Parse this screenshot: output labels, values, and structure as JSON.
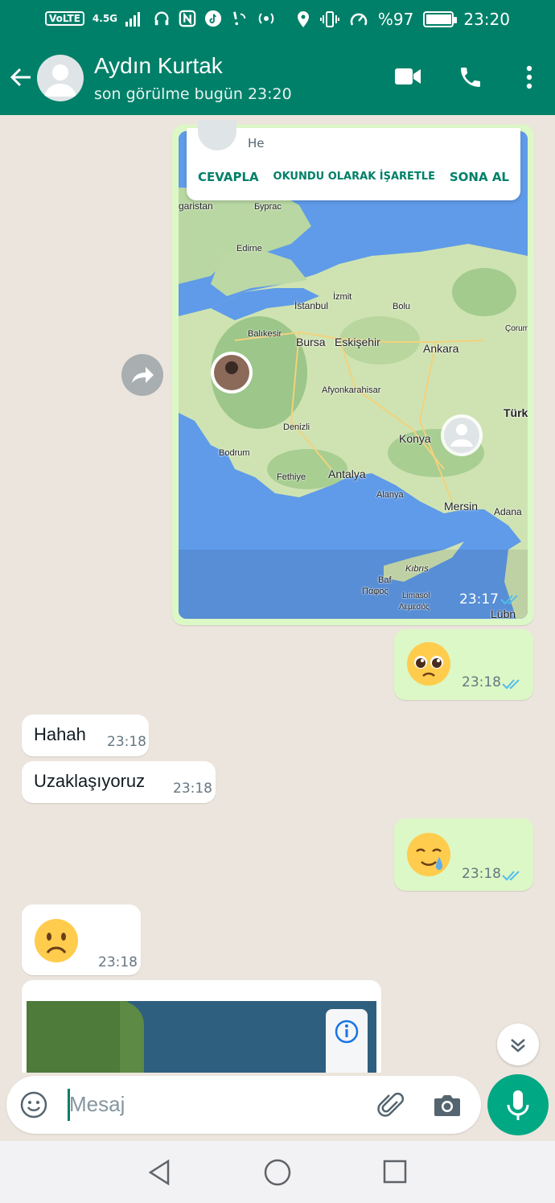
{
  "status_bar": {
    "volte": "VoLTE",
    "network": "4.5G",
    "battery_percent": "%97",
    "battery_level": 0.97,
    "time": "23:20"
  },
  "header": {
    "contact_name": "Aydın Kurtak",
    "last_seen": "son görülme bugün 23:20",
    "icons": [
      "back-arrow-icon",
      "avatar",
      "video-call-icon",
      "phone-icon",
      "more-vert-icon"
    ]
  },
  "notification": {
    "message": "He",
    "actions": [
      "CEVAPLA",
      "OKUNDU OLARAK İŞARETLE",
      "SONA AL"
    ]
  },
  "map_labels": {
    "garistan": "garistan",
    "burgas": "Бургас",
    "edirne": "Edirne",
    "istanbul": "İstanbul",
    "izmit": "İzmit",
    "bolu": "Bolu",
    "corum": "Çorum",
    "balikesir": "Balıkesir",
    "bursa": "Bursa",
    "eskisehir": "Eskişehir",
    "ankara": "Ankara",
    "afyon": "Afyonkarahisar",
    "turk": "Türk",
    "denizli": "Denizli",
    "konya": "Konya",
    "bodrum": "Bodrum",
    "fethiye": "Fethiye",
    "antalya": "Antalya",
    "alanya": "Alanya",
    "mersin": "Mersin",
    "adana": "Adana",
    "kibris": "Kıbrıs",
    "baf": "Baf",
    "pafos": "Πάφος",
    "limasol": "Limasol",
    "lemesos": "Λεμεσός",
    "lubn": "Lübn"
  },
  "messages": [
    {
      "direction": "out",
      "type": "location",
      "time": "23:17",
      "status": "read"
    },
    {
      "direction": "out",
      "type": "emoji",
      "content": "🥺",
      "time": "23:18",
      "status": "read"
    },
    {
      "direction": "in",
      "type": "text",
      "content": "Hahah",
      "time": "23:18"
    },
    {
      "direction": "in",
      "type": "text",
      "content": "Uzaklaşıyoruz",
      "time": "23:18"
    },
    {
      "direction": "out",
      "type": "emoji",
      "content": "🥲",
      "time": "23:18",
      "status": "read"
    },
    {
      "direction": "in",
      "type": "emoji",
      "content": "☹️",
      "time": "23:18"
    }
  ],
  "composer": {
    "placeholder": "Mesaj"
  },
  "colors": {
    "brand": "#008069",
    "accent": "#00a884",
    "outgoing_bubble": "#dcf8c6",
    "incoming_bubble": "#ffffff",
    "read_tick": "#53bdeb",
    "chat_bg": "#ece5dd"
  }
}
